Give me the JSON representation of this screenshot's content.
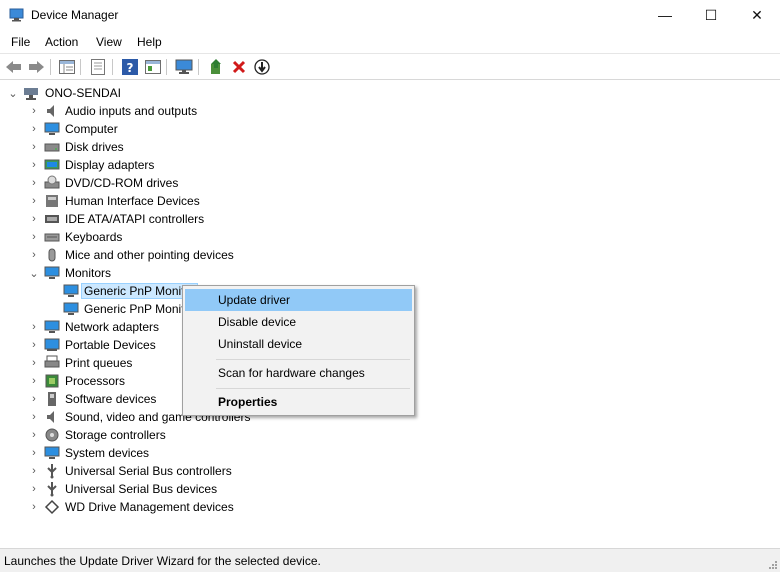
{
  "window": {
    "title": "Device Manager",
    "minimize_glyph": "—",
    "maximize_glyph": "☐",
    "close_glyph": "✕"
  },
  "menu": [
    "File",
    "Action",
    "View",
    "Help"
  ],
  "toolbar": {
    "icons": [
      "back-arrow-icon",
      "forward-arrow-icon",
      "show-hide-tree-icon",
      "properties-icon",
      "help-icon",
      "view-options-icon",
      "scan-hardware-icon",
      "update-driver-icon",
      "uninstall-device-icon",
      "disable-device-icon"
    ]
  },
  "tree": {
    "root": "ONO-SENDAI",
    "categories": [
      {
        "label": "Audio inputs and outputs",
        "icon": "speaker-icon"
      },
      {
        "label": "Computer",
        "icon": "computer-icon"
      },
      {
        "label": "Disk drives",
        "icon": "disk-drive-icon"
      },
      {
        "label": "Display adapters",
        "icon": "display-adapter-icon"
      },
      {
        "label": "DVD/CD-ROM drives",
        "icon": "dvd-drive-icon"
      },
      {
        "label": "Human Interface Devices",
        "icon": "hid-icon"
      },
      {
        "label": "IDE ATA/ATAPI controllers",
        "icon": "ide-controller-icon"
      },
      {
        "label": "Keyboards",
        "icon": "keyboard-icon"
      },
      {
        "label": "Mice and other pointing devices",
        "icon": "mouse-icon"
      },
      {
        "label": "Monitors",
        "icon": "monitor-icon",
        "expanded": true
      },
      {
        "label": "Network adapters",
        "icon": "network-adapter-icon"
      },
      {
        "label": "Portable Devices",
        "icon": "portable-device-icon"
      },
      {
        "label": "Print queues",
        "icon": "printer-icon"
      },
      {
        "label": "Processors",
        "icon": "processor-icon"
      },
      {
        "label": "Software devices",
        "icon": "software-device-icon"
      },
      {
        "label": "Sound, video and game controllers",
        "icon": "sound-controller-icon"
      },
      {
        "label": "Storage controllers",
        "icon": "storage-controller-icon"
      },
      {
        "label": "System devices",
        "icon": "system-device-icon"
      },
      {
        "label": "Universal Serial Bus controllers",
        "icon": "usb-icon"
      },
      {
        "label": "Universal Serial Bus devices",
        "icon": "usb-icon"
      },
      {
        "label": "WD Drive Management devices",
        "icon": "wd-device-icon"
      }
    ],
    "monitor_children": [
      "Generic PnP Monitor",
      "Generic PnP Monitor"
    ]
  },
  "context_menu": {
    "items": [
      "Update driver",
      "Disable device",
      "Uninstall device",
      "Scan for hardware changes",
      "Properties"
    ],
    "highlighted": "Update driver",
    "default": "Properties"
  },
  "status": {
    "text": "Launches the Update Driver Wizard for the selected device."
  },
  "colors": {
    "selection": "#cce8ff",
    "menu_hover": "#91c9f7",
    "monitor_blue": "#1e88e5"
  }
}
